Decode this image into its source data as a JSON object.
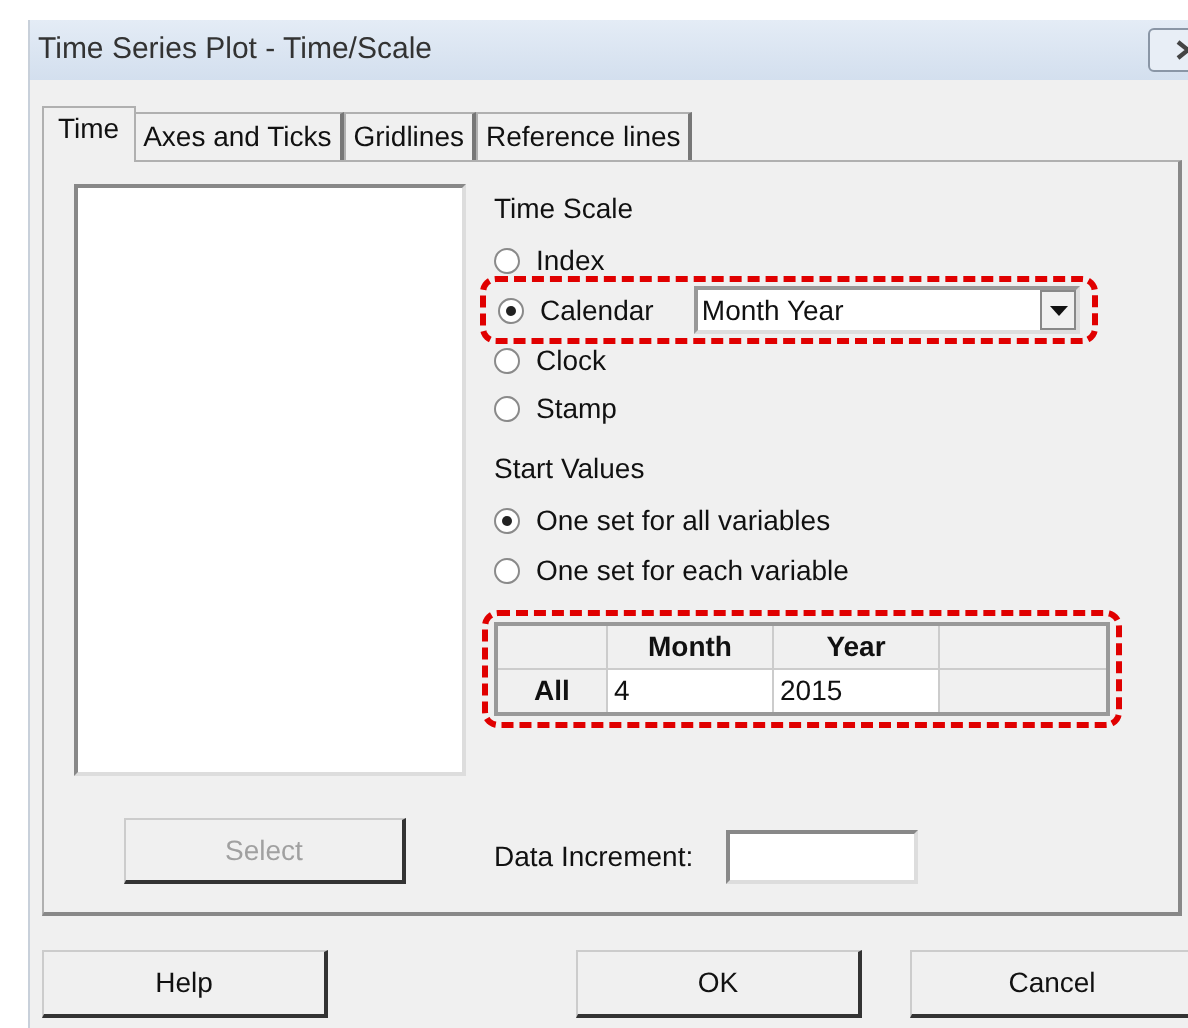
{
  "window": {
    "title": "Time Series Plot - Time/Scale"
  },
  "tabs": [
    {
      "label": "Time",
      "selected": true
    },
    {
      "label": "Axes and Ticks",
      "selected": false
    },
    {
      "label": "Gridlines",
      "selected": false
    },
    {
      "label": "Reference lines",
      "selected": false
    }
  ],
  "time_scale": {
    "label": "Time Scale",
    "options": [
      {
        "kind": "plain",
        "label": "Index",
        "selected": false,
        "highlighted": false
      },
      {
        "kind": "with_dropdown",
        "label": "Calendar",
        "selected": true,
        "highlighted": true,
        "dropdown_value": "Month Year"
      },
      {
        "kind": "plain",
        "label": "Clock",
        "selected": false,
        "highlighted": false
      },
      {
        "kind": "plain",
        "label": "Stamp",
        "selected": false,
        "highlighted": false
      }
    ]
  },
  "start_values": {
    "label": "Start Values",
    "options": [
      {
        "label": "One set for all variables",
        "selected": true
      },
      {
        "label": "One set for each variable",
        "selected": false
      }
    ],
    "table": {
      "highlighted": true,
      "columns": [
        "Month",
        "Year"
      ],
      "rows": [
        {
          "label": "All",
          "cells": [
            "4",
            "2015"
          ]
        }
      ]
    }
  },
  "select_button": {
    "label": "Select",
    "disabled": true
  },
  "data_increment": {
    "label": "Data Increment:"
  },
  "buttons": [
    {
      "label": "Help"
    },
    {
      "label": "OK"
    },
    {
      "label": "Cancel"
    }
  ]
}
